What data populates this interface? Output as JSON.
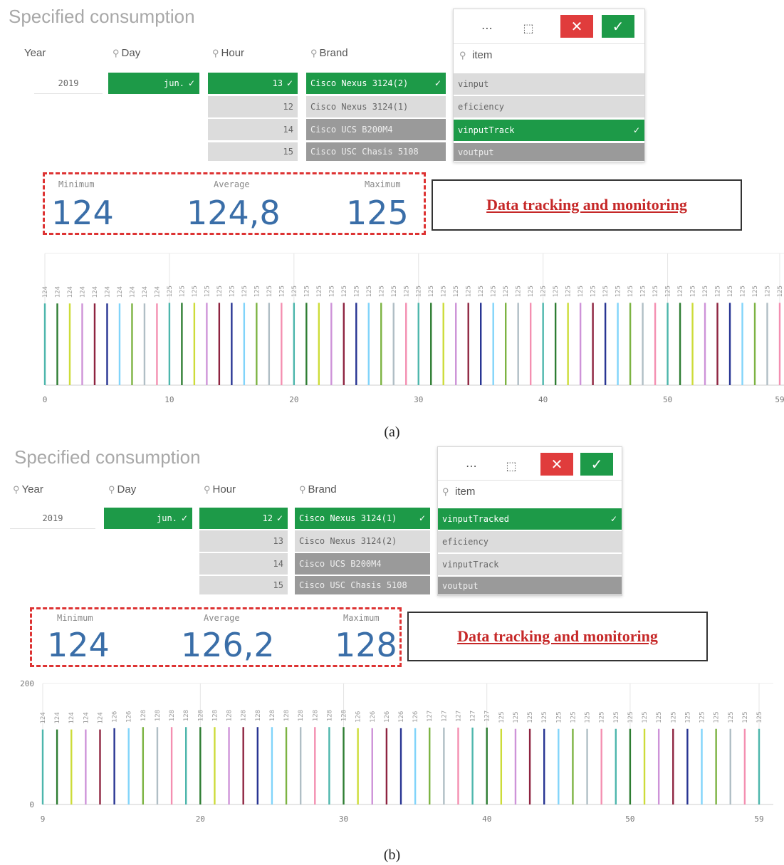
{
  "panel_a": {
    "title": "Specified consumption",
    "filters": {
      "year": {
        "label": "Year",
        "value": "2019"
      },
      "day": {
        "label": "Day",
        "selected": "jun."
      },
      "hour": {
        "label": "Hour",
        "selected": "13",
        "others": [
          "12",
          "14",
          "15"
        ]
      },
      "brand": {
        "label": "Brand",
        "selected": "Cisco Nexus 3124(2)",
        "alternative": "Cisco Nexus 3124(1)",
        "excluded": [
          "Cisco UCS B200M4",
          "Cisco USC Chasis 5108"
        ]
      },
      "item": {
        "label": "item",
        "values": [
          "vinput",
          "eficiency",
          "vinputTrack",
          "voutput"
        ],
        "selected": "vinputTrack"
      }
    },
    "toolbar": {
      "more_icon": "more-icon",
      "clear_icon": "clear-selection-icon",
      "cancel_icon": "close-icon",
      "confirm_icon": "check-icon"
    },
    "kpis": {
      "min_label": "Minimum",
      "min_value": "124",
      "avg_label": "Average",
      "avg_value": "124,8",
      "max_label": "Maximum",
      "max_value": "125"
    },
    "callout": "Data tracking and monitoring",
    "caption": "(a)"
  },
  "panel_b": {
    "title": "Specified consumption",
    "filters": {
      "year": {
        "label": "Year",
        "value": "2019"
      },
      "day": {
        "label": "Day",
        "selected": "jun."
      },
      "hour": {
        "label": "Hour",
        "selected": "12",
        "others": [
          "13",
          "14",
          "15"
        ]
      },
      "brand": {
        "label": "Brand",
        "selected": "Cisco Nexus 3124(1)",
        "alternative": "Cisco Nexus 3124(2)",
        "excluded": [
          "Cisco UCS B200M4",
          "Cisco USC Chasis 5108"
        ]
      },
      "item": {
        "label": "item",
        "values": [
          "vinputTracked",
          "eficiency",
          "vinputTrack",
          "voutput"
        ],
        "selected": "vinputTracked"
      }
    },
    "toolbar": {
      "more_icon": "more-icon",
      "clear_icon": "clear-selection-icon",
      "cancel_icon": "close-icon",
      "confirm_icon": "check-icon"
    },
    "kpis": {
      "min_label": "Minimum",
      "min_value": "124",
      "avg_label": "Average",
      "avg_value": "126,2",
      "max_label": "Maximum",
      "max_value": "128"
    },
    "callout": "Data tracking and monitoring",
    "caption": "(b)"
  },
  "palette": [
    "#4db6ac",
    "#2e7d32",
    "#cddc39",
    "#ce93d8",
    "#8e2440",
    "#283593",
    "#81d4fa",
    "#7cb342",
    "#b0bec5",
    "#f48fb1"
  ],
  "chart_data": [
    {
      "type": "bar",
      "title": "",
      "xlabel": "",
      "ylabel": "",
      "x": [
        0,
        1,
        2,
        3,
        4,
        5,
        6,
        7,
        8,
        9,
        10,
        11,
        12,
        13,
        14,
        15,
        16,
        17,
        18,
        19,
        20,
        21,
        22,
        23,
        24,
        25,
        26,
        27,
        28,
        29,
        30,
        31,
        32,
        33,
        34,
        35,
        36,
        37,
        38,
        39,
        40,
        41,
        42,
        43,
        44,
        45,
        46,
        47,
        48,
        49,
        50,
        51,
        52,
        53,
        54,
        55,
        56,
        57,
        58,
        59
      ],
      "values": [
        124,
        124,
        124,
        124,
        124,
        124,
        124,
        124,
        124,
        124,
        125,
        125,
        125,
        125,
        125,
        125,
        125,
        125,
        125,
        125,
        125,
        125,
        125,
        125,
        125,
        125,
        125,
        125,
        125,
        125,
        125,
        125,
        125,
        125,
        125,
        125,
        125,
        125,
        125,
        125,
        125,
        125,
        125,
        125,
        125,
        125,
        125,
        125,
        125,
        125,
        125,
        125,
        125,
        125,
        125,
        125,
        125,
        125,
        125,
        125
      ],
      "xticks": [
        0,
        10,
        20,
        30,
        40,
        50,
        59
      ],
      "xlim": [
        0,
        59
      ],
      "ylim": [
        0,
        200
      ],
      "y_axis_labels_shown": false,
      "grid": true
    },
    {
      "type": "bar",
      "title": "",
      "xlabel": "",
      "ylabel": "",
      "x": [
        9,
        10,
        11,
        12,
        13,
        14,
        15,
        16,
        17,
        18,
        19,
        20,
        21,
        22,
        23,
        24,
        25,
        26,
        27,
        28,
        29,
        30,
        31,
        32,
        33,
        34,
        35,
        36,
        37,
        38,
        39,
        40,
        41,
        42,
        43,
        44,
        45,
        46,
        47,
        48,
        49,
        50,
        51,
        52,
        53,
        54,
        55,
        56,
        57,
        58,
        59
      ],
      "values": [
        124,
        124,
        124,
        124,
        124,
        126,
        126,
        128,
        128,
        128,
        128,
        128,
        128,
        128,
        128,
        128,
        128,
        128,
        128,
        128,
        128,
        128,
        126,
        126,
        126,
        126,
        126,
        127,
        127,
        127,
        127,
        127,
        125,
        125,
        125,
        125,
        125,
        125,
        125,
        125,
        125,
        125,
        125,
        125,
        125,
        125,
        125,
        125,
        125,
        125,
        125
      ],
      "xticks": [
        9,
        20,
        30,
        40,
        50,
        59
      ],
      "xlim": [
        9,
        59
      ],
      "ylim": [
        0,
        200
      ],
      "yticks": [
        0,
        200
      ],
      "y_axis_labels_shown": true,
      "grid": true
    }
  ]
}
